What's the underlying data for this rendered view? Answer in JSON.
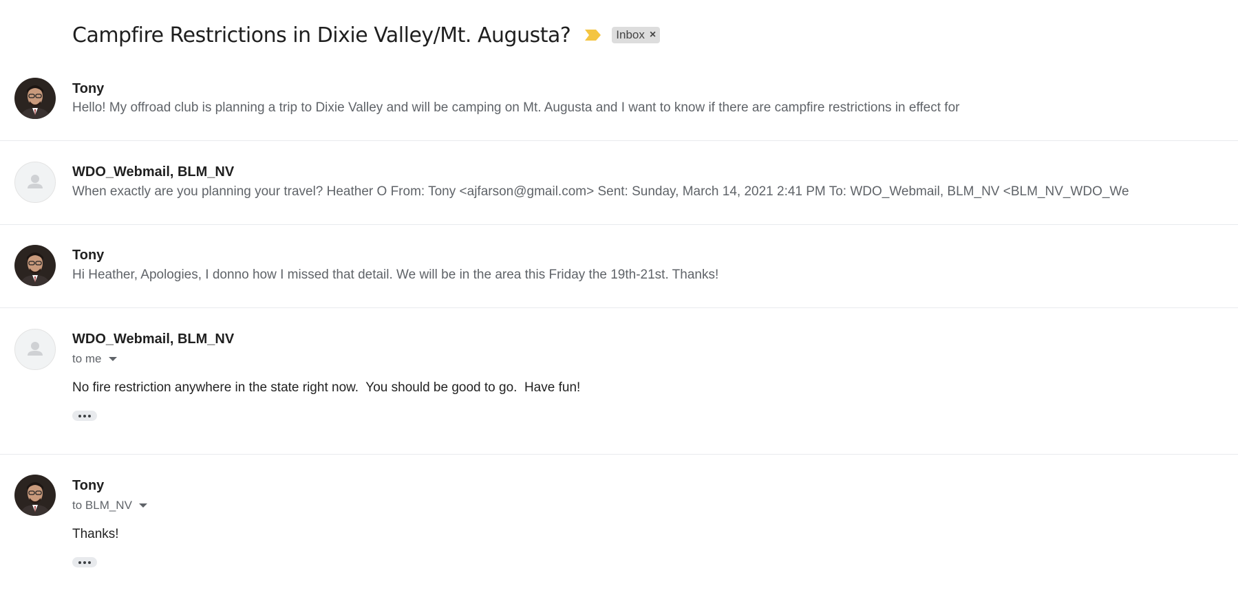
{
  "thread": {
    "subject": "Campfire Restrictions in Dixie Valley/Mt. Augusta?",
    "label": "Inbox",
    "label_remove": "×",
    "importance_color": "#f4c542"
  },
  "messages": [
    {
      "sender": "Tony",
      "snippet": "Hello! My offroad club is planning a trip to Dixie Valley and will be camping on Mt. Augusta and I want to know if there are campfire restrictions in effect for",
      "avatar": "photo"
    },
    {
      "sender": "WDO_Webmail, BLM_NV",
      "snippet": "When exactly are you planning your travel? Heather O From: Tony <ajfarson@gmail.com> Sent: Sunday, March 14, 2021 2:41 PM To: WDO_Webmail, BLM_NV <BLM_NV_WDO_We",
      "avatar": "placeholder"
    },
    {
      "sender": "Tony",
      "snippet": "Hi Heather, Apologies, I donno how I missed that detail. We will be in the area this Friday the 19th-21st. Thanks!",
      "avatar": "photo"
    },
    {
      "sender": "WDO_Webmail, BLM_NV",
      "to": "to me",
      "body": "No fire restriction anywhere in the state right now.  You should be good to go.  Have fun!",
      "avatar": "placeholder"
    },
    {
      "sender": "Tony",
      "to": "to BLM_NV",
      "body": "Thanks!",
      "avatar": "photo"
    }
  ]
}
